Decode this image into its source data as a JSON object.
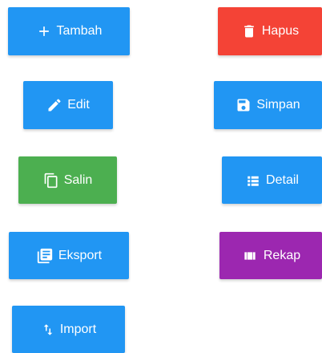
{
  "buttons": {
    "tambah": {
      "label": "Tambah",
      "icon": "plus-icon",
      "color": "#2196f3"
    },
    "hapus": {
      "label": "Hapus",
      "icon": "trash-icon",
      "color": "#f44336"
    },
    "edit": {
      "label": "Edit",
      "icon": "pencil-icon",
      "color": "#2196f3"
    },
    "simpan": {
      "label": "Simpan",
      "icon": "floppy-disk-icon",
      "color": "#2196f3"
    },
    "salin": {
      "label": "Salin",
      "icon": "copy-icon",
      "color": "#4caf50"
    },
    "detail": {
      "label": "Detail",
      "icon": "list-detail-icon",
      "color": "#2196f3"
    },
    "eksport": {
      "label": "Eksport",
      "icon": "library-books-icon",
      "color": "#2196f3"
    },
    "rekap": {
      "label": "Rekap",
      "icon": "view-columns-icon",
      "color": "#9c27b0"
    },
    "import": {
      "label": "Import",
      "icon": "swap-vertical-icon",
      "color": "#2196f3"
    }
  }
}
